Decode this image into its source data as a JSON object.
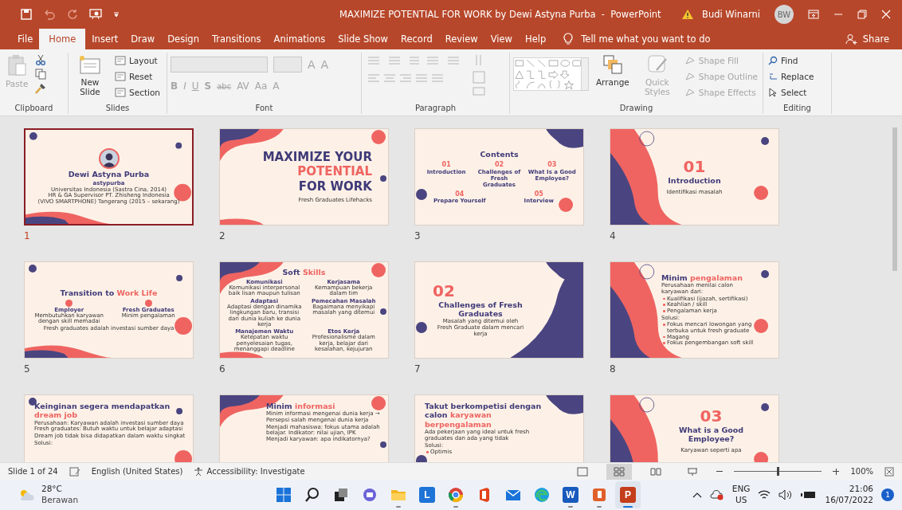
{
  "window": {
    "title": "MAXIMIZE POTENTIAL FOR WORK by Dewi Astyna Purba  -  PowerPoint",
    "user": "Budi Winarni",
    "initials": "BW"
  },
  "tabs": [
    {
      "label": "File",
      "selected": false
    },
    {
      "label": "Home",
      "selected": true
    },
    {
      "label": "Insert",
      "selected": false
    },
    {
      "label": "Draw",
      "selected": false
    },
    {
      "label": "Design",
      "selected": false
    },
    {
      "label": "Transitions",
      "selected": false
    },
    {
      "label": "Animations",
      "selected": false
    },
    {
      "label": "Slide Show",
      "selected": false
    },
    {
      "label": "Record",
      "selected": false
    },
    {
      "label": "Review",
      "selected": false
    },
    {
      "label": "View",
      "selected": false
    },
    {
      "label": "Help",
      "selected": false
    }
  ],
  "tell_me": {
    "placeholder": "Tell me what you want to do"
  },
  "share": "Share",
  "ribbon": {
    "clipboard": {
      "label": "Clipboard",
      "paste": "Paste",
      "paste_disabled": true
    },
    "slides": {
      "label": "Slides",
      "new_slide": "New Slide",
      "buttons": [
        "Layout",
        "Reset",
        "Section"
      ]
    },
    "font": {
      "label": "Font",
      "disabled": true,
      "size_buttons": [
        "A",
        "A"
      ],
      "buttons": [
        "B",
        "I",
        "U",
        "S",
        "abc",
        "AV",
        "Aa",
        "A"
      ]
    },
    "paragraph": {
      "label": "Paragraph"
    },
    "drawing": {
      "label": "Drawing",
      "arrange": "Arrange",
      "quick_styles": "Quick Styles",
      "quick_styles_disabled": true,
      "shape_buttons": [
        {
          "label": "Shape Fill",
          "disabled": true
        },
        {
          "label": "Shape Outline",
          "disabled": true
        },
        {
          "label": "Shape Effects",
          "disabled": true
        }
      ]
    },
    "editing": {
      "label": "Editing",
      "buttons": [
        {
          "kind": "find",
          "label": "Find"
        },
        {
          "kind": "replace",
          "label": "Replace"
        },
        {
          "kind": "select",
          "label": "Select"
        }
      ]
    }
  },
  "slides": [
    {
      "number": "1",
      "selected": true,
      "blocks": [
        {
          "kind": "photo"
        },
        {
          "kind": "title",
          "segments": [
            {
              "text": "Dewi Astyna Purba",
              "accent": false
            }
          ]
        },
        {
          "kind": "handle",
          "text": "astypurba"
        },
        {
          "kind": "small",
          "lines": [
            "Universitas Indonesia (Sastra Cina, 2014)",
            "HR & GA Supervisor PT. Zhisheng Indonesia",
            "(VIVO SMARTPHONE) Tangerang (2015 – sekarang)"
          ]
        }
      ]
    },
    {
      "number": "2",
      "selected": false,
      "blocks": [
        {
          "kind": "display",
          "segments": [
            {
              "text": "MAXIMIZE YOUR",
              "accent": false
            }
          ]
        },
        {
          "kind": "display",
          "segments": [
            {
              "text": "POTENTIAL",
              "accent": true
            }
          ]
        },
        {
          "kind": "display",
          "segments": [
            {
              "text": "FOR WORK",
              "accent": false
            }
          ]
        },
        {
          "kind": "text",
          "text": "Fresh Graduates Lifehacks"
        }
      ]
    },
    {
      "number": "3",
      "selected": false,
      "blocks": [
        {
          "kind": "title",
          "segments": [
            {
              "text": "Contents",
              "accent": false
            }
          ]
        },
        {
          "kind": "grid",
          "cells": [
            {
              "number": "01",
              "heading": "Introduction"
            },
            {
              "number": "02",
              "heading": "Challenges of Fresh Graduates"
            },
            {
              "number": "03",
              "heading": "What Is a Good Employee?"
            }
          ]
        },
        {
          "kind": "grid",
          "cells": [
            {
              "number": "04",
              "heading": "Prepare Yourself"
            },
            {
              "number": "05",
              "heading": "Interview"
            }
          ]
        }
      ]
    },
    {
      "number": "4",
      "selected": false,
      "blocks": [
        {
          "kind": "number",
          "text": "01"
        },
        {
          "kind": "title",
          "segments": [
            {
              "text": "Introduction",
              "accent": false
            }
          ]
        },
        {
          "kind": "text",
          "text": "Identifikasi masalah"
        }
      ]
    },
    {
      "number": "5",
      "selected": false,
      "blocks": [
        {
          "kind": "title",
          "segments": [
            {
              "text": "Transition to ",
              "accent": false
            },
            {
              "text": "Work Life",
              "accent": true
            }
          ]
        },
        {
          "kind": "grid",
          "icons": true,
          "cells": [
            {
              "heading": "Employer",
              "body": "Membutuhkan karyawan dengan skill memadai"
            },
            {
              "heading": "Fresh Graduates",
              "body": "Minim pengalaman"
            }
          ]
        },
        {
          "kind": "small",
          "lines": [
            "Fresh graduates adalah investasi sumber daya"
          ]
        }
      ]
    },
    {
      "number": "6",
      "selected": false,
      "blocks": [
        {
          "kind": "title",
          "segments": [
            {
              "text": "Soft ",
              "accent": false
            },
            {
              "text": "Skills",
              "accent": true
            }
          ]
        },
        {
          "kind": "grid",
          "cells": [
            {
              "heading": "Komunikasi",
              "body": "Komunikasi interpersonal baik lisan maupun tulisan"
            },
            {
              "heading": "Kerjasama",
              "body": "Kemampuan bekerja dalam tim"
            },
            {
              "heading": "Adaptasi",
              "body": "Adaptasi dengan dinamika lingkungan baru, transisi dari dunia kuliah ke dunia kerja"
            },
            {
              "heading": "Pemecahan Masalah",
              "body": "Bagaimana menyikapi masalah yang ditemui"
            },
            {
              "heading": "Manajemen Waktu",
              "body": "Ketepatan waktu penyelesaian tugas, menanggapi deadline"
            },
            {
              "heading": "Etos Kerja",
              "body": "Profesionalisme dalam kerja, belajar dari kesalahan, kejujuran"
            }
          ]
        }
      ]
    },
    {
      "number": "7",
      "selected": false,
      "blocks": [
        {
          "kind": "number",
          "text": "02"
        },
        {
          "kind": "title",
          "segments": [
            {
              "text": "Challenges of Fresh Graduates",
              "accent": false
            }
          ]
        },
        {
          "kind": "small",
          "lines": [
            "Masalah yang ditemui oleh",
            "Fresh Graduate dalam mencari kerja"
          ]
        }
      ]
    },
    {
      "number": "8",
      "selected": false,
      "blocks": [
        {
          "kind": "title",
          "segments": [
            {
              "text": "Minim ",
              "accent": false
            },
            {
              "text": "pengalaman",
              "accent": true
            }
          ]
        },
        {
          "kind": "small",
          "lines": [
            "Perusahaan menilai calon karyawan dari:"
          ]
        },
        {
          "kind": "bullets",
          "items": [
            "Kualifikasi (ijazah, sertifikasi)",
            "Keahlian / skill",
            "Pengalaman kerja"
          ]
        },
        {
          "kind": "small",
          "lines": [
            "Solusi:"
          ]
        },
        {
          "kind": "bullets",
          "items": [
            "Fokus mencari lowongan yang terbuka untuk fresh graduate",
            "Magang",
            "Fokus pengembangan soft skill"
          ]
        }
      ]
    },
    {
      "selected": false,
      "blocks": [
        {
          "kind": "title",
          "segments": [
            {
              "text": "Keinginan segera mendapatkan ",
              "accent": false
            },
            {
              "text": "dream job",
              "accent": true
            }
          ]
        },
        {
          "kind": "small",
          "lines": [
            "Perusahaan: Karyawan adalah investasi sumber daya",
            "Fresh graduates: Butuh waktu untuk belajar adaptasi"
          ]
        },
        {
          "kind": "small",
          "lines": [
            "Dream job tidak bisa didapatkan dalam waktu singkat"
          ]
        },
        {
          "kind": "small",
          "lines": [
            "Solusi:"
          ]
        }
      ]
    },
    {
      "selected": false,
      "blocks": [
        {
          "kind": "title",
          "segments": [
            {
              "text": "Minim ",
              "accent": false
            },
            {
              "text": "informasi",
              "accent": true
            }
          ]
        },
        {
          "kind": "small",
          "lines": [
            "Minim informasi mengenai dunia kerja → Persepsi salah mengenai dunia kerja"
          ]
        },
        {
          "kind": "small",
          "lines": [
            "Menjadi mahasiswa: fokus utama adalah belajar. Indikator: nilai ujian, IPK",
            "Menjadi karyawan: apa indikatornya?"
          ]
        }
      ]
    },
    {
      "selected": false,
      "blocks": [
        {
          "kind": "title",
          "segments": [
            {
              "text": "Takut berkompetisi dengan calon ",
              "accent": false
            },
            {
              "text": "karyawan berpengalaman",
              "accent": true
            }
          ]
        },
        {
          "kind": "small",
          "lines": [
            "Ada pekerjaan yang ideal untuk fresh graduates dan ada yang tidak"
          ]
        },
        {
          "kind": "small",
          "lines": [
            "Solusi:"
          ]
        },
        {
          "kind": "bullets",
          "items": [
            "Optimis"
          ]
        }
      ]
    },
    {
      "selected": false,
      "blocks": [
        {
          "kind": "number",
          "text": "03"
        },
        {
          "kind": "title",
          "segments": [
            {
              "text": "What is a Good Employee?",
              "accent": false
            }
          ]
        },
        {
          "kind": "text",
          "text": "Karyawan seperti apa"
        }
      ]
    }
  ],
  "status_bar": {
    "slide": "Slide 1 of 24",
    "language": "English (United States)",
    "accessibility": "Accessibility: Investigate",
    "views": [
      {
        "kind": "normal",
        "selected": false
      },
      {
        "kind": "sorter",
        "selected": true
      },
      {
        "kind": "reading",
        "selected": false
      },
      {
        "kind": "show",
        "selected": false
      }
    ],
    "zoom": {
      "level": 0.5,
      "reading": "100%"
    }
  },
  "taskbar": {
    "weather": {
      "temp": "28°C",
      "text": "Berawan"
    },
    "apps": [
      {
        "kind": "start",
        "running": false,
        "selected": false
      },
      {
        "kind": "search",
        "running": false,
        "selected": false
      },
      {
        "kind": "taskview",
        "running": false,
        "selected": false
      },
      {
        "kind": "chat",
        "running": false,
        "selected": false
      },
      {
        "kind": "explorer",
        "running": true,
        "selected": false
      },
      {
        "kind": "letter",
        "letter": "L",
        "color": "#1e73d6",
        "running": false,
        "selected": false
      },
      {
        "kind": "chrome",
        "running": true,
        "selected": false
      },
      {
        "kind": "office",
        "running": false,
        "selected": false
      },
      {
        "kind": "mail",
        "running": false,
        "selected": false
      },
      {
        "kind": "edge",
        "running": false,
        "selected": false
      },
      {
        "kind": "letter",
        "letter": "W",
        "color": "#185abd",
        "running": true,
        "selected": false
      },
      {
        "kind": "pages",
        "running": true,
        "selected": false
      },
      {
        "kind": "letter",
        "letter": "P",
        "color": "#c43e1c",
        "running": true,
        "selected": true
      }
    ],
    "lang": [
      "ENG",
      "US"
    ],
    "time": "21:06",
    "date": "16/07/2022",
    "badge": "1"
  }
}
